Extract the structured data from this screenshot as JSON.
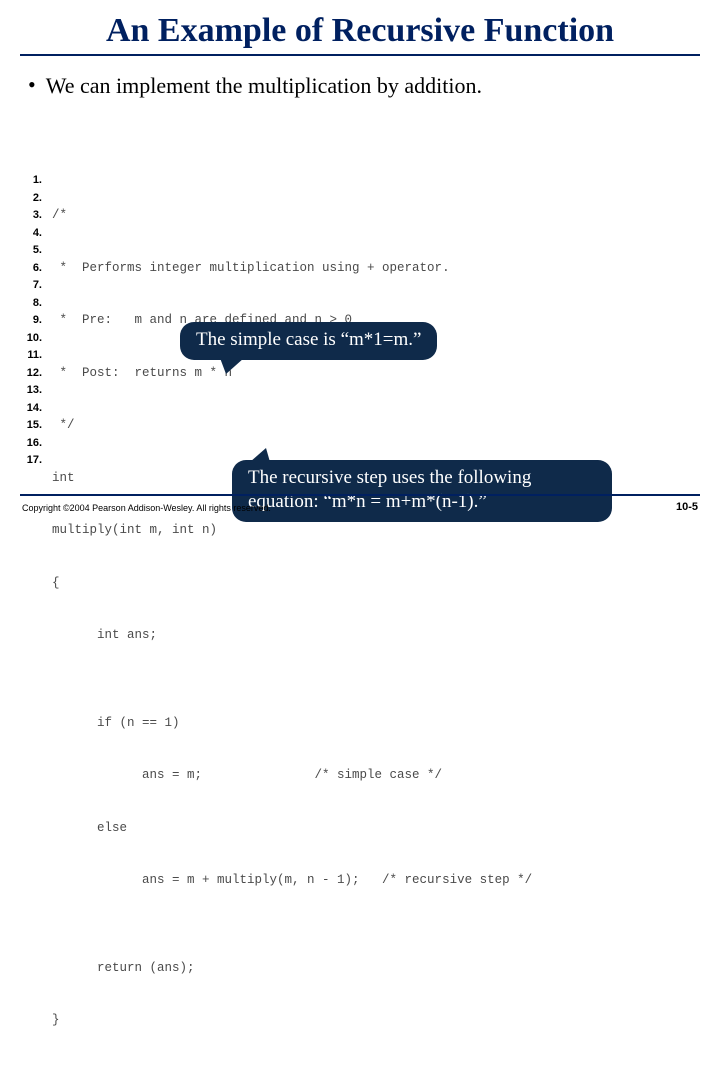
{
  "title": "An Example of Recursive Function",
  "bullet": "We can implement the multiplication by addition.",
  "code": {
    "lineNumbers": [
      "1.",
      "2.",
      "3.",
      "4.",
      "5.",
      "6.",
      "7.",
      "8.",
      "9.",
      "10.",
      "11.",
      "12.",
      "13.",
      "14.",
      "15.",
      "16.",
      "17."
    ],
    "lines": [
      "/*",
      " *  Performs integer multiplication using + operator.",
      " *  Pre:   m and n are defined and n > 0",
      " *  Post:  returns m * n",
      " */",
      "int",
      "multiply(int m, int n)",
      "{",
      "      int ans;",
      "",
      "      if (n == 1)",
      "            ans = m;               /* simple case */",
      "      else",
      "            ans = m + multiply(m, n - 1);   /* recursive step */",
      "",
      "      return (ans);",
      "}"
    ]
  },
  "bubble1": "The simple case is “m*1=m.”",
  "bubble2_line1": "The recursive step uses the following",
  "bubble2_line2": "equation: “m*n = m+m*(n-1).”",
  "copyright": "Copyright ©2004 Pearson Addison-Wesley. All rights reserved.",
  "pagenum": "10-5"
}
